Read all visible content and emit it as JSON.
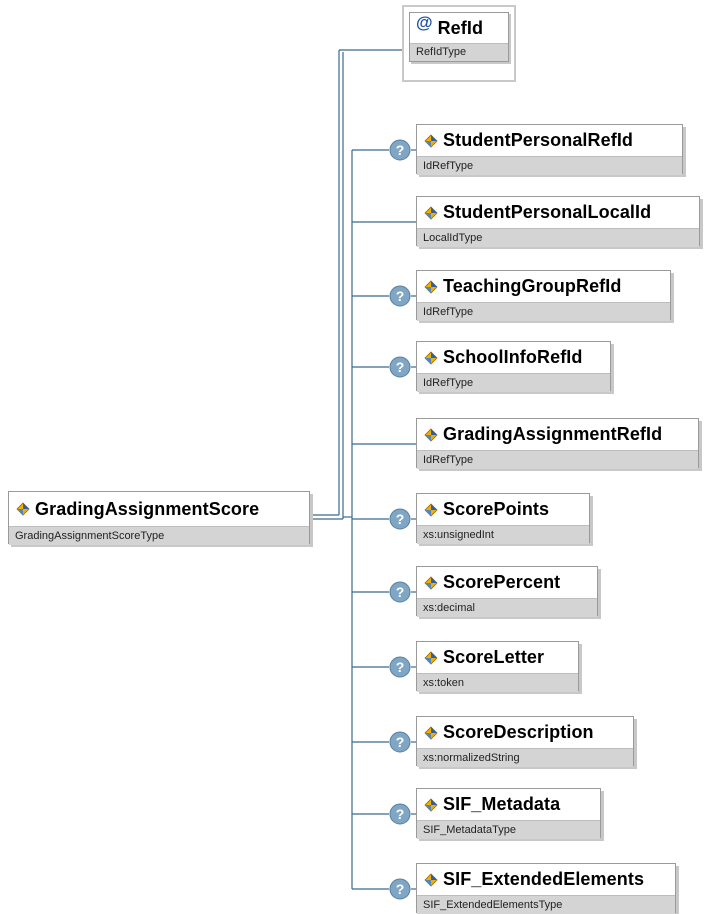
{
  "root": {
    "name": "GradingAssignmentScore",
    "type": "GradingAssignmentScoreType",
    "icon": "element-icon"
  },
  "attribute": {
    "name": "RefId",
    "type": "RefIdType",
    "icon": "attribute-icon",
    "symbol": "@"
  },
  "children": [
    {
      "name": "StudentPersonalRefId",
      "type": "IdRefType",
      "optional": true,
      "icon": "element-icon"
    },
    {
      "name": "StudentPersonalLocalId",
      "type": "LocalIdType",
      "optional": false,
      "icon": "element-icon"
    },
    {
      "name": "TeachingGroupRefId",
      "type": "IdRefType",
      "optional": true,
      "icon": "element-icon"
    },
    {
      "name": "SchoolInfoRefId",
      "type": "IdRefType",
      "optional": true,
      "icon": "element-icon"
    },
    {
      "name": "GradingAssignmentRefId",
      "type": "IdRefType",
      "optional": false,
      "icon": "element-icon"
    },
    {
      "name": "ScorePoints",
      "type": "xs:unsignedInt",
      "optional": true,
      "icon": "element-icon"
    },
    {
      "name": "ScorePercent",
      "type": "xs:decimal",
      "optional": true,
      "icon": "element-icon"
    },
    {
      "name": "ScoreLetter",
      "type": "xs:token",
      "optional": true,
      "icon": "element-icon"
    },
    {
      "name": "ScoreDescription",
      "type": "xs:normalizedString",
      "optional": true,
      "icon": "element-icon"
    },
    {
      "name": "SIF_Metadata",
      "type": "SIF_MetadataType",
      "optional": true,
      "icon": "element-icon"
    },
    {
      "name": "SIF_ExtendedElements",
      "type": "SIF_ExtendedElementsType",
      "optional": true,
      "icon": "element-icon"
    }
  ],
  "colors": {
    "connector": "#3a6a8c",
    "optional_badge": "#7fa6c4",
    "type_bar": "#d4d4d4"
  }
}
